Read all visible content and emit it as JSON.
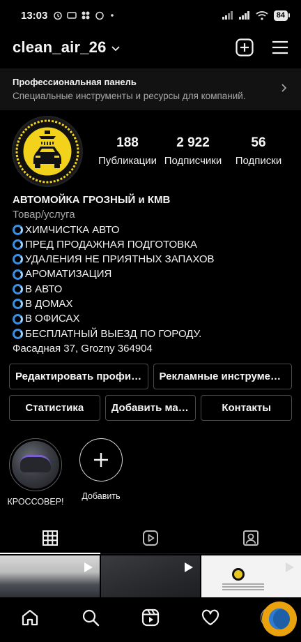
{
  "status_bar": {
    "time": "13:03",
    "battery": "84"
  },
  "header": {
    "username": "clean_air_26"
  },
  "pro_panel": {
    "title": "Профессиональная панель",
    "subtitle": "Специальные инструменты и ресурсы для компаний."
  },
  "stats": [
    {
      "value": "188",
      "label": "Публикации"
    },
    {
      "value": "2 922",
      "label": "Подписчики"
    },
    {
      "value": "56",
      "label": "Подписки"
    }
  ],
  "bio": {
    "name": "АВТОМОЙКА ГРОЗНЫЙ и КМВ",
    "category": "Товар/услуга",
    "lines": [
      "ХИМЧИСТКА АВТО",
      "ПРЕД ПРОДАЖНАЯ ПОДГОТОВКА",
      "УДАЛЕНИЯ НЕ ПРИЯТНЫХ ЗАПАХОВ",
      "АРОМАТИЗАЦИЯ",
      "В АВТО",
      "В ДОМАХ",
      "В ОФИСАХ",
      "БЕСПЛАТНЫЙ ВЫЕЗД ПО ГОРОДУ."
    ],
    "address": "Фасадная 37, Grozny 364904"
  },
  "buttons": {
    "edit_profile": "Редактировать профиль",
    "ad_tools": "Рекламные инструменты",
    "stats": "Статистика",
    "add": "Добавить магазин",
    "contacts": "Контакты"
  },
  "highlights": [
    {
      "label": "КРОССОВЕР!"
    },
    {
      "label": "Добавить"
    }
  ],
  "colors": {
    "background": "#000000",
    "bio_bullet": "#3b8fe0",
    "logo_yellow": "#f2d21b"
  }
}
